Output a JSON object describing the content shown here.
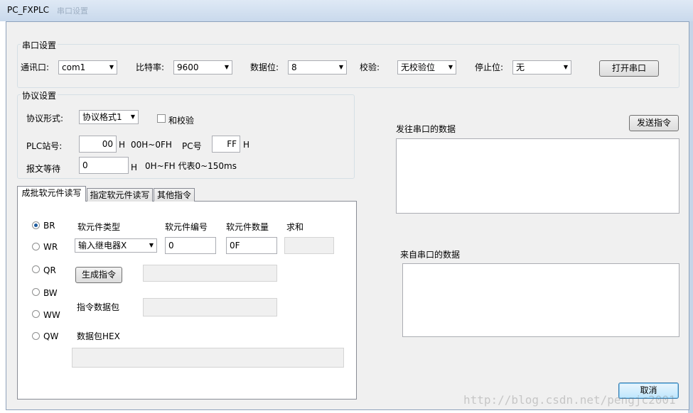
{
  "window": {
    "title": "PC_FXPLC",
    "ghost_title": "串口设置"
  },
  "serial": {
    "group_label": "串口设置",
    "port_label": "通讯口:",
    "port_value": "com1",
    "baud_label": "比特率:",
    "baud_value": "9600",
    "databits_label": "数据位:",
    "databits_value": "8",
    "parity_label": "校验:",
    "parity_value": "无校验位",
    "stopbits_label": "停止位:",
    "stopbits_value": "无",
    "open_button": "打开串口"
  },
  "protocol": {
    "group_label": "协议设置",
    "format_label": "协议形式:",
    "format_value": "协议格式1",
    "checksum_label": "和校验",
    "station_label": "PLC站号:",
    "station_value": "00",
    "station_unit": "H",
    "station_range": "00H~0FH",
    "pc_label": "PC号",
    "pc_value": "FF",
    "pc_unit": "H",
    "wait_label": "报文等待",
    "wait_value": "0",
    "wait_unit": "H",
    "wait_range": "0H~FH 代表0~150ms"
  },
  "tabs": [
    {
      "label": "成批软元件读写"
    },
    {
      "label": "指定软元件读写"
    },
    {
      "label": "其他指令"
    }
  ],
  "batch": {
    "radios": [
      "BR",
      "WR",
      "QR",
      "BW",
      "WW",
      "QW"
    ],
    "selected": "BR",
    "type_header": "软元件类型",
    "number_header": "软元件编号",
    "count_header": "软元件数量",
    "sum_header": "求和",
    "type_value": "输入继电器X",
    "number_value": "0",
    "count_value": "0F",
    "generate_button": "生成指令",
    "packet_label": "指令数据包",
    "hex_label": "数据包HEX"
  },
  "right": {
    "send_label": "发往串口的数据",
    "send_button": "发送指令",
    "recv_label": "来自串口的数据",
    "cancel_button": "取消"
  },
  "watermark": "http://blog.csdn.net/pengjc2001"
}
